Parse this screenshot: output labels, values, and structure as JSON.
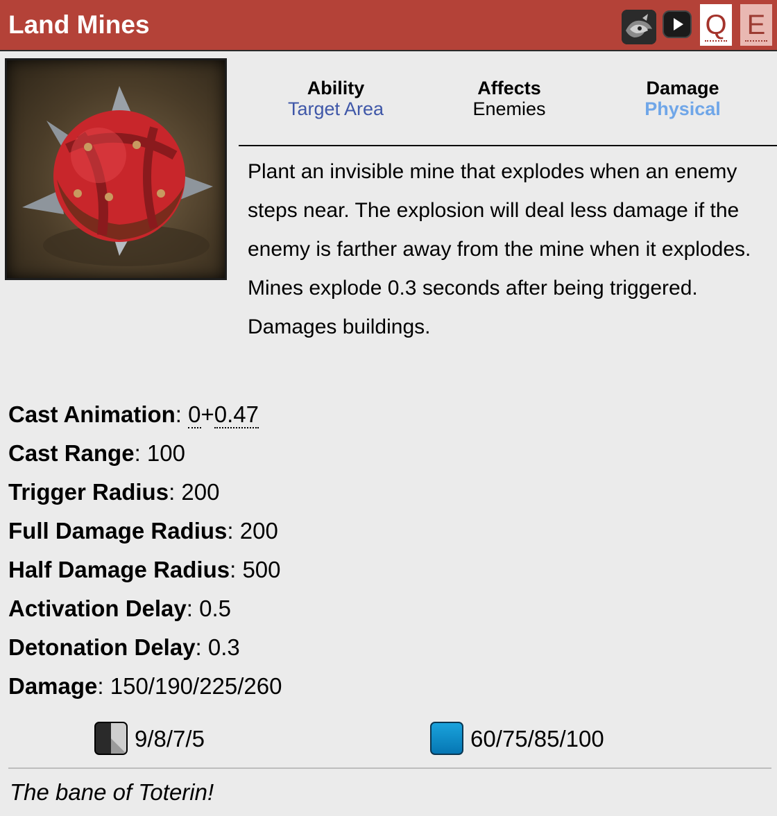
{
  "header": {
    "title": "Land Mines",
    "hero_icon": "hero-portrait-icon",
    "play_icon": "play-icon",
    "hotkey_q": "Q",
    "hotkey_e": "E",
    "color": "#b44238"
  },
  "ability_icon": "land-mines-ability-icon",
  "meta": {
    "ability_label": "Ability",
    "ability_value": "Target Area",
    "affects_label": "Affects",
    "affects_value": "Enemies",
    "damage_label": "Damage",
    "damage_value": "Physical"
  },
  "description": "Plant an invisible mine that explodes when an enemy steps near. The explosion will deal less damage if the enemy is farther away from the mine when it explodes. Mines explode 0.3 seconds after being triggered. Damages buildings.",
  "stats": {
    "cast_animation": {
      "label": "Cast Animation",
      "value_a": "0",
      "plus": "+",
      "value_b": "0.47"
    },
    "cast_range": {
      "label": "Cast Range",
      "value": "100"
    },
    "trigger_radius": {
      "label": "Trigger Radius",
      "value": "200"
    },
    "full_damage_radius": {
      "label": "Full Damage Radius",
      "value": "200"
    },
    "half_damage_radius": {
      "label": "Half Damage Radius",
      "value": "500"
    },
    "activation_delay": {
      "label": "Activation Delay",
      "value": "0.5"
    },
    "detonation_delay": {
      "label": "Detonation Delay",
      "value": "0.3"
    },
    "damage": {
      "label": "Damage",
      "value": "150/190/225/260"
    }
  },
  "cooldown": {
    "icon": "cooldown-icon",
    "value": "9/8/7/5"
  },
  "mana": {
    "icon": "mana-icon",
    "value": "60/75/85/100"
  },
  "lore": "The bane of Toterin!"
}
